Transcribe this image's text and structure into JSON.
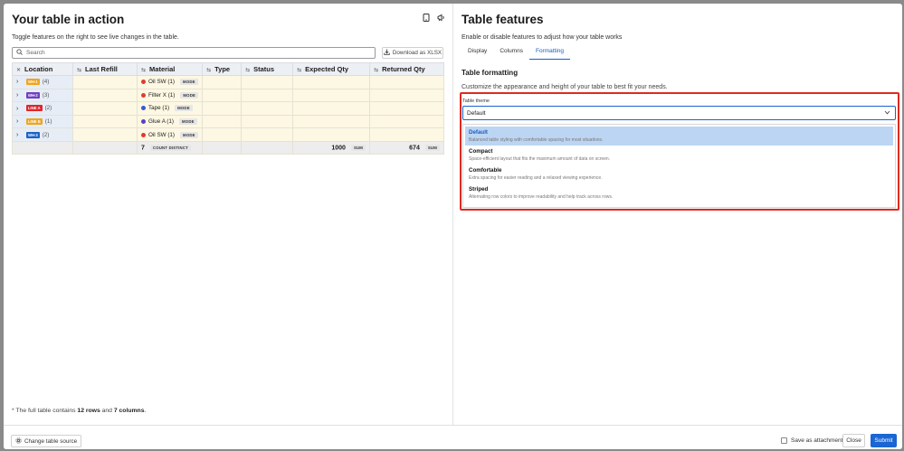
{
  "left": {
    "title": "Your table in action",
    "subtitle": "Toggle features on the right to see live changes in the table.",
    "search_placeholder": "Search",
    "download_label": "Download as XLSX",
    "icons": [
      "device-icon",
      "megaphone-icon"
    ],
    "columns": [
      "Location",
      "Last Refill",
      "Material",
      "Type",
      "Status",
      "Expected Qty",
      "Returned Qty"
    ],
    "rows": [
      {
        "tag": "WH-1",
        "tag_color": "#f0a51c",
        "count": "(4)",
        "material": "Oil SW (1)",
        "dot_color": "#e23b2e",
        "agg": "MODE"
      },
      {
        "tag": "WH-2",
        "tag_color": "#6f3fc2",
        "count": "(3)",
        "material": "Filter X (1)",
        "dot_color": "#e23b2e",
        "agg": "MODE"
      },
      {
        "tag": "LINE A",
        "tag_color": "#e0262a",
        "count": "(2)",
        "material": "Tape (1)",
        "dot_color": "#3a55d6",
        "agg": "MODE"
      },
      {
        "tag": "LINE B",
        "tag_color": "#f0a51c",
        "count": "(1)",
        "material": "Glue A (1)",
        "dot_color": "#5b3fc2",
        "agg": "MODE"
      },
      {
        "tag": "WH-3",
        "tag_color": "#1b63c9",
        "count": "(2)",
        "material": "Oil SW (1)",
        "dot_color": "#e23b2e",
        "agg": "MODE"
      }
    ],
    "totals": {
      "material_count": "7",
      "material_agg": "COUNT DISTINCT",
      "expected": "1000",
      "expected_agg": "SUM",
      "returned": "674",
      "returned_agg": "SUM"
    },
    "footnote_prefix": "* The full table contains ",
    "footnote_rows": "12 rows",
    "footnote_mid": " and ",
    "footnote_cols": "7 columns",
    "footnote_suffix": "."
  },
  "right": {
    "title": "Table features",
    "subtitle": "Enable or disable features to adjust how your table works",
    "tabs": [
      "Display",
      "Columns",
      "Formatting"
    ],
    "active_tab": "Formatting",
    "section_title": "Table formatting",
    "section_subtitle": "Customize the appearance and height of your table to best fit your needs.",
    "field_label": "Table theme",
    "select_value": "Default",
    "options": [
      {
        "title": "Default",
        "desc": "Balanced table styling with comfortable spacing for most situations."
      },
      {
        "title": "Compact",
        "desc": "Space-efficient layout that fits the maximum amount of data on screen."
      },
      {
        "title": "Comfortable",
        "desc": "Extra spacing for easier reading and a relaxed viewing experience."
      },
      {
        "title": "Striped",
        "desc": "Alternating row colors to improve readability and help track across rows."
      }
    ],
    "highlight_color": "#e02a20"
  },
  "footer": {
    "source_label": "Change table source",
    "save_attachment_label": "Save as attachment",
    "close_label": "Close",
    "submit_label": "Submit"
  }
}
